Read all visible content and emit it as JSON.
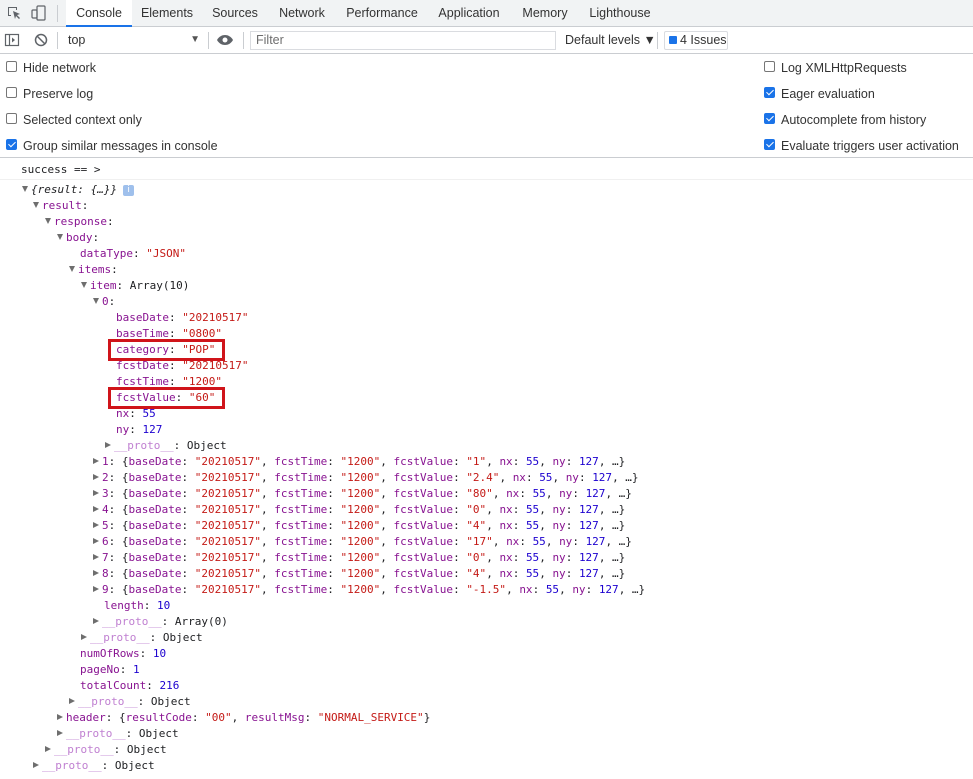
{
  "tabs": [
    "Console",
    "Elements",
    "Sources",
    "Network",
    "Performance",
    "Application",
    "Memory",
    "Lighthouse"
  ],
  "toolbar": {
    "context": "top",
    "filter_placeholder": "Filter",
    "levels": "Default levels ▼",
    "issues": "4 Issues"
  },
  "settings": {
    "left": [
      {
        "label": "Hide network",
        "checked": false
      },
      {
        "label": "Preserve log",
        "checked": false
      },
      {
        "label": "Selected context only",
        "checked": false
      },
      {
        "label": "Group similar messages in console",
        "checked": true
      }
    ],
    "right": [
      {
        "label": "Log XMLHttpRequests",
        "checked": false
      },
      {
        "label": "Eager evaluation",
        "checked": true
      },
      {
        "label": "Autocomplete from history",
        "checked": true
      },
      {
        "label": "Evaluate triggers user activation",
        "checked": true
      }
    ]
  },
  "console": {
    "message": "success == >",
    "root": "{result: {…}}",
    "info_badge": "i",
    "keys": {
      "result": "result",
      "response": "response",
      "body": "body",
      "dataType_key": "dataType",
      "dataType_val": "\"JSON\"",
      "items": "items",
      "item_key": "item",
      "item_val": "Array(10)",
      "index0": "0",
      "baseDate_key": "baseDate",
      "baseDate_val": "\"20210517\"",
      "baseTime_key": "baseTime",
      "baseTime_val": "\"0800\"",
      "category_key": "category",
      "category_val": "\"POP\"",
      "fcstDate_key": "fcstDate",
      "fcstDate_val": "\"20210517\"",
      "fcstTime_key": "fcstTime",
      "fcstTime_val": "\"1200\"",
      "fcstValue_key": "fcstValue",
      "fcstValue_val": "\"60\"",
      "nx_key": "nx",
      "nx_val": "55",
      "ny_key": "ny",
      "ny_val": "127",
      "proto": "__proto__",
      "object": "Object",
      "length_key": "length",
      "length_val": "10",
      "array0": "Array(0)",
      "numOfRows_key": "numOfRows",
      "numOfRows_val": "10",
      "pageNo_key": "pageNo",
      "pageNo_val": "1",
      "totalCount_key": "totalCount",
      "totalCount_val": "216",
      "header_key": "header",
      "resultCode_key": "resultCode",
      "resultCode_val": "\"00\"",
      "resultMsg_key": "resultMsg",
      "resultMsg_val": "\"NORMAL_SERVICE\""
    },
    "array_items": [
      {
        "idx": "1",
        "fcstValue": "\"1\""
      },
      {
        "idx": "2",
        "fcstValue": "\"2.4\""
      },
      {
        "idx": "3",
        "fcstValue": "\"80\""
      },
      {
        "idx": "4",
        "fcstValue": "\"0\""
      },
      {
        "idx": "5",
        "fcstValue": "\"4\""
      },
      {
        "idx": "6",
        "fcstValue": "\"17\""
      },
      {
        "idx": "7",
        "fcstValue": "\"0\""
      },
      {
        "idx": "8",
        "fcstValue": "\"4\""
      },
      {
        "idx": "9",
        "fcstValue": "\"-1.5\""
      }
    ],
    "array_item_base": {
      "baseDate": "\"20210517\"",
      "fcstTime": "\"1200\"",
      "nx": "55",
      "ny": "127",
      "tail": "…}"
    }
  }
}
